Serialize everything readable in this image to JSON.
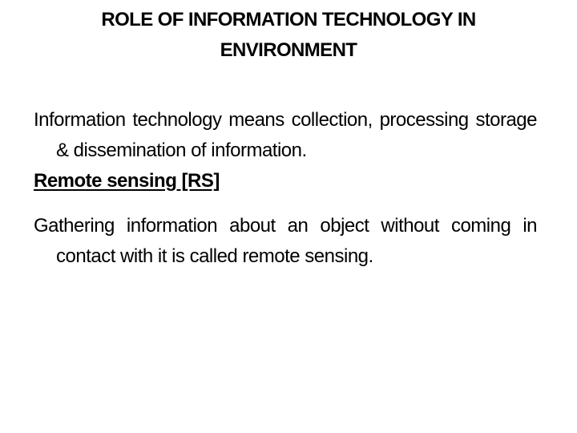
{
  "slide": {
    "title": "ROLE OF INFORMATION TECHNOLOGY IN ENVIRONMENT",
    "paragraphs": [
      {
        "text": "Information technology means collection, processing storage & dissemination of information."
      }
    ],
    "section": {
      "heading": "Remote sensing [RS]",
      "text": "Gathering information about an object without coming in contact with it is called remote sensing."
    }
  }
}
